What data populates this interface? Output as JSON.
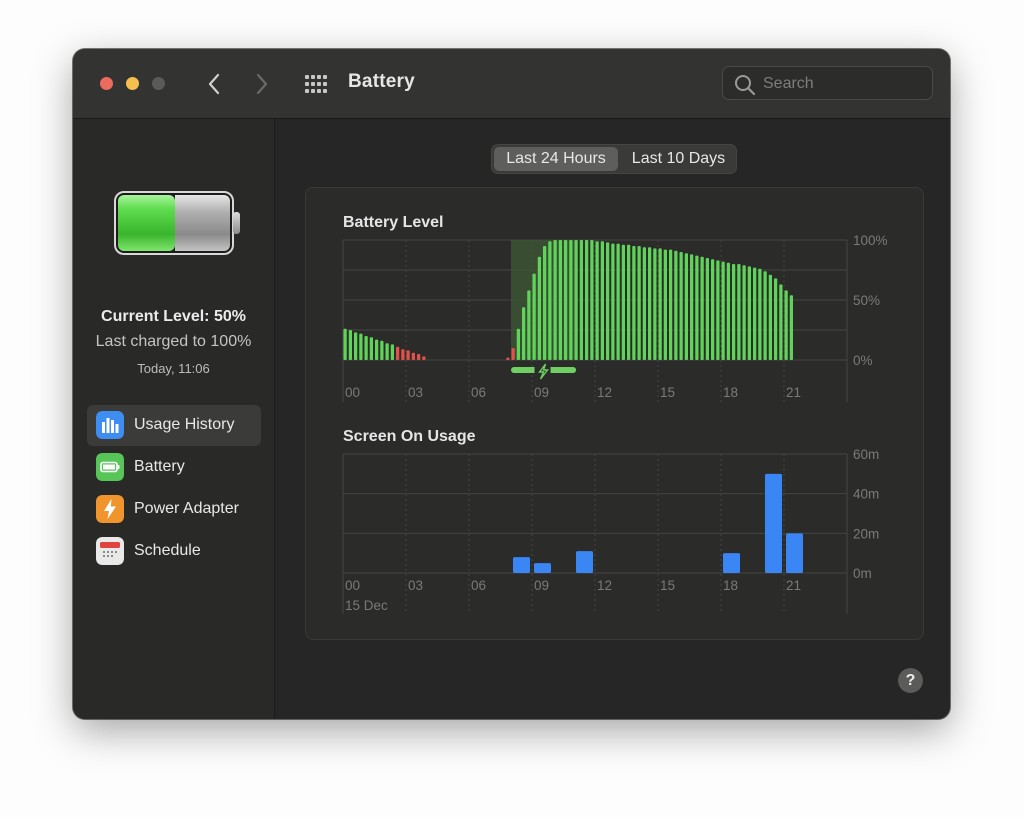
{
  "window": {
    "title": "Battery",
    "search_placeholder": "Search"
  },
  "sidebar": {
    "current_level": "Current Level: 50%",
    "last_charged": "Last charged to 100%",
    "charged_time": "Today, 11:06",
    "items": [
      {
        "label": "Usage History",
        "icon": "bar-chart-icon",
        "selected": true
      },
      {
        "label": "Battery",
        "icon": "battery-icon",
        "selected": false
      },
      {
        "label": "Power Adapter",
        "icon": "lightning-icon",
        "selected": false
      },
      {
        "label": "Schedule",
        "icon": "calendar-icon",
        "selected": false
      }
    ]
  },
  "tabs": [
    {
      "label": "Last 24 Hours",
      "selected": true
    },
    {
      "label": "Last 10 Days",
      "selected": false
    }
  ],
  "colors": {
    "battery_green": "#5fd35a",
    "battery_low_red": "#e0524a",
    "screen_blue": "#3a86f5",
    "charging_band": "#3d5a36"
  },
  "chart_data": [
    {
      "type": "bar",
      "title": "Battery Level",
      "x_tick_labels": [
        "00",
        "03",
        "06",
        "09",
        "12",
        "15",
        "18",
        "21"
      ],
      "y_tick_labels": [
        "100%",
        "50%",
        "0%"
      ],
      "ylim": [
        0,
        100
      ],
      "x_unit": "hour",
      "x_range": [
        0,
        24
      ],
      "charging_interval_hours": [
        8.0,
        11.1
      ],
      "bars": [
        {
          "x": 0.0,
          "v": 26
        },
        {
          "x": 0.25,
          "v": 25
        },
        {
          "x": 0.5,
          "v": 23
        },
        {
          "x": 0.75,
          "v": 22
        },
        {
          "x": 1.0,
          "v": 20
        },
        {
          "x": 1.25,
          "v": 19
        },
        {
          "x": 1.5,
          "v": 17
        },
        {
          "x": 1.75,
          "v": 16
        },
        {
          "x": 2.0,
          "v": 14
        },
        {
          "x": 2.25,
          "v": 13
        },
        {
          "x": 2.5,
          "v": 11,
          "low": true
        },
        {
          "x": 2.75,
          "v": 9,
          "low": true
        },
        {
          "x": 3.0,
          "v": 8,
          "low": true
        },
        {
          "x": 3.25,
          "v": 6,
          "low": true
        },
        {
          "x": 3.5,
          "v": 5,
          "low": true
        },
        {
          "x": 3.75,
          "v": 3,
          "low": true
        },
        {
          "x": 7.75,
          "v": 2,
          "low": true
        },
        {
          "x": 8.0,
          "v": 10,
          "low": true
        },
        {
          "x": 8.25,
          "v": 26
        },
        {
          "x": 8.5,
          "v": 44
        },
        {
          "x": 8.75,
          "v": 58
        },
        {
          "x": 9.0,
          "v": 72
        },
        {
          "x": 9.25,
          "v": 86
        },
        {
          "x": 9.5,
          "v": 95
        },
        {
          "x": 9.75,
          "v": 99
        },
        {
          "x": 10.0,
          "v": 100
        },
        {
          "x": 10.25,
          "v": 100
        },
        {
          "x": 10.5,
          "v": 100
        },
        {
          "x": 10.75,
          "v": 100
        },
        {
          "x": 11.0,
          "v": 100
        },
        {
          "x": 11.25,
          "v": 100
        },
        {
          "x": 11.5,
          "v": 100
        },
        {
          "x": 11.75,
          "v": 100
        },
        {
          "x": 12.0,
          "v": 99
        },
        {
          "x": 12.25,
          "v": 99
        },
        {
          "x": 12.5,
          "v": 98
        },
        {
          "x": 12.75,
          "v": 97
        },
        {
          "x": 13.0,
          "v": 97
        },
        {
          "x": 13.25,
          "v": 96
        },
        {
          "x": 13.5,
          "v": 96
        },
        {
          "x": 13.75,
          "v": 95
        },
        {
          "x": 14.0,
          "v": 95
        },
        {
          "x": 14.25,
          "v": 94
        },
        {
          "x": 14.5,
          "v": 94
        },
        {
          "x": 14.75,
          "v": 93
        },
        {
          "x": 15.0,
          "v": 93
        },
        {
          "x": 15.25,
          "v": 92
        },
        {
          "x": 15.5,
          "v": 92
        },
        {
          "x": 15.75,
          "v": 91
        },
        {
          "x": 16.0,
          "v": 90
        },
        {
          "x": 16.25,
          "v": 89
        },
        {
          "x": 16.5,
          "v": 88
        },
        {
          "x": 16.75,
          "v": 87
        },
        {
          "x": 17.0,
          "v": 86
        },
        {
          "x": 17.25,
          "v": 85
        },
        {
          "x": 17.5,
          "v": 84
        },
        {
          "x": 17.75,
          "v": 83
        },
        {
          "x": 18.0,
          "v": 82
        },
        {
          "x": 18.25,
          "v": 81
        },
        {
          "x": 18.5,
          "v": 80
        },
        {
          "x": 18.75,
          "v": 80
        },
        {
          "x": 19.0,
          "v": 79
        },
        {
          "x": 19.25,
          "v": 78
        },
        {
          "x": 19.5,
          "v": 77
        },
        {
          "x": 19.75,
          "v": 76
        },
        {
          "x": 20.0,
          "v": 74
        },
        {
          "x": 20.25,
          "v": 71
        },
        {
          "x": 20.5,
          "v": 68
        },
        {
          "x": 20.75,
          "v": 63
        },
        {
          "x": 21.0,
          "v": 58
        },
        {
          "x": 21.25,
          "v": 54
        }
      ]
    },
    {
      "type": "bar",
      "title": "Screen On Usage",
      "x_tick_labels": [
        "00",
        "03",
        "06",
        "09",
        "12",
        "15",
        "18",
        "21"
      ],
      "date_label": "15 Dec",
      "y_tick_labels": [
        "60m",
        "40m",
        "20m",
        "0m"
      ],
      "ylim": [
        0,
        60
      ],
      "x_unit": "hour",
      "x_range": [
        0,
        24
      ],
      "bars": [
        {
          "hour": 8,
          "minutes": 8
        },
        {
          "hour": 9,
          "minutes": 5
        },
        {
          "hour": 11,
          "minutes": 11
        },
        {
          "hour": 18,
          "minutes": 10
        },
        {
          "hour": 20,
          "minutes": 50
        },
        {
          "hour": 21,
          "minutes": 20
        }
      ]
    }
  ]
}
